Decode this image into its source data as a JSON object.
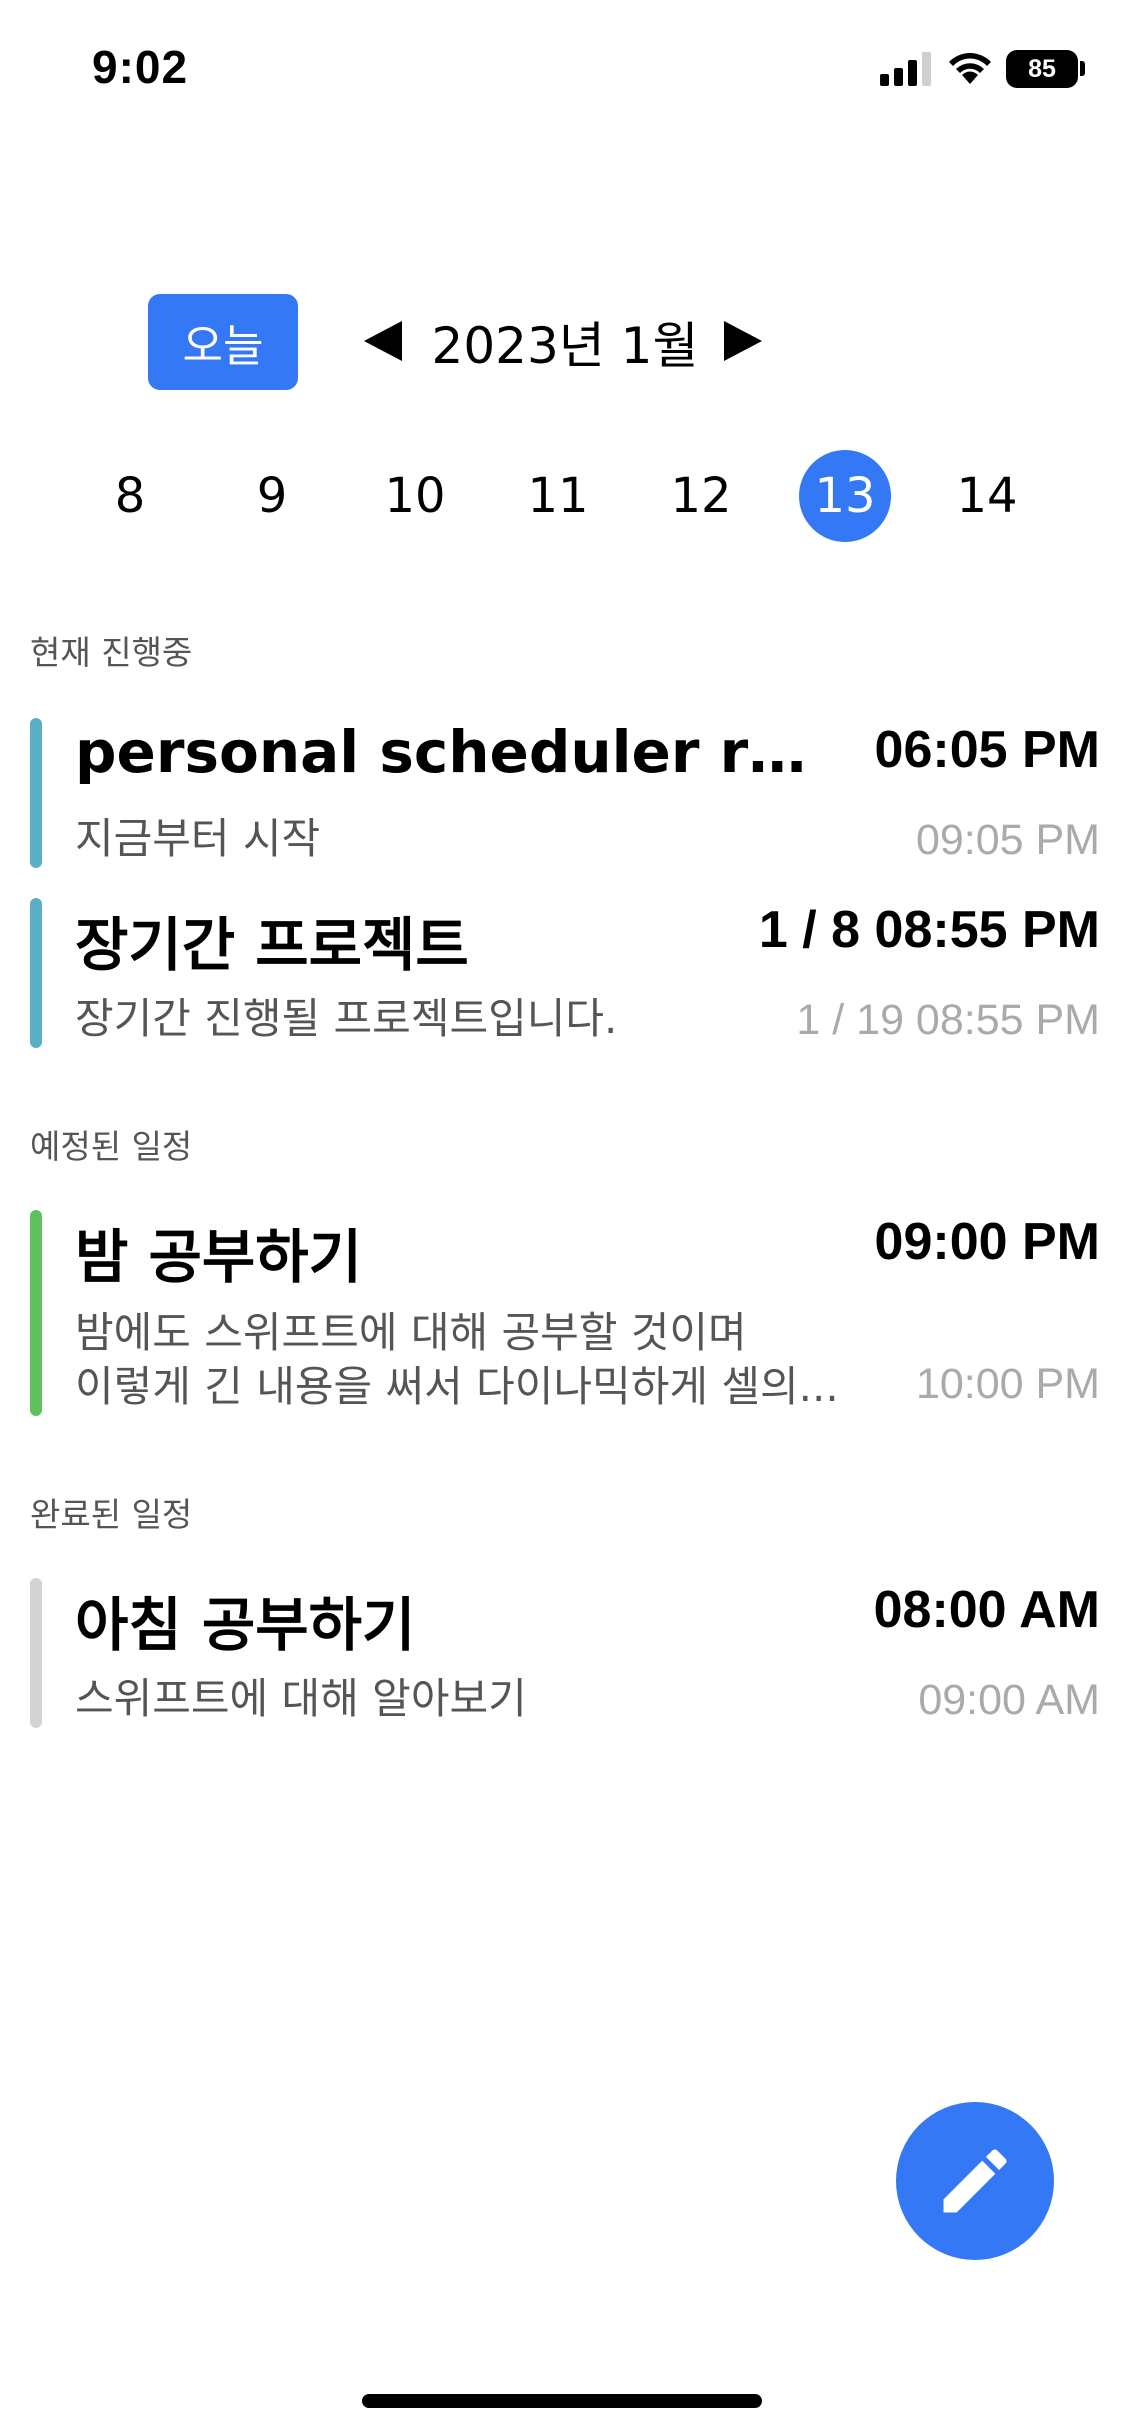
{
  "status_bar": {
    "time": "9:02",
    "battery": "85"
  },
  "header": {
    "today_label": "오늘",
    "month_label": "2023년 1월"
  },
  "days": [
    "8",
    "9",
    "10",
    "11",
    "12",
    "13",
    "14"
  ],
  "selected_day": "13",
  "sections": {
    "in_progress": {
      "label": "현재 진행중",
      "items": [
        {
          "title": "personal scheduler read...",
          "description": "지금부터 시작",
          "start": "06:05 PM",
          "end": "09:05 PM",
          "color": "#5AAFC6"
        },
        {
          "title": "장기간 프로젝트",
          "description": "장기간 진행될 프로젝트입니다.",
          "start": "1 / 8 08:55 PM",
          "end": "1 / 19 08:55 PM",
          "color": "#5AAFC6"
        }
      ]
    },
    "scheduled": {
      "label": "예정된 일정",
      "items": [
        {
          "title": "밤 공부하기",
          "description": "밤에도 스위프트에 대해 공부할 것이며\n이렇게 긴 내용을 써서 다이나믹하게 셀의...",
          "start": "09:00 PM",
          "end": "10:00 PM",
          "color": "#5DC25E"
        }
      ]
    },
    "completed": {
      "label": "완료된 일정",
      "items": [
        {
          "title": "아침 공부하기",
          "description": "스위프트에 대해 알아보기",
          "start": "08:00 AM",
          "end": "09:00 AM",
          "color": "#D3D3D6"
        }
      ]
    }
  },
  "colors": {
    "accent": "#3478F6"
  },
  "fab": {
    "icon": "pencil-icon"
  }
}
